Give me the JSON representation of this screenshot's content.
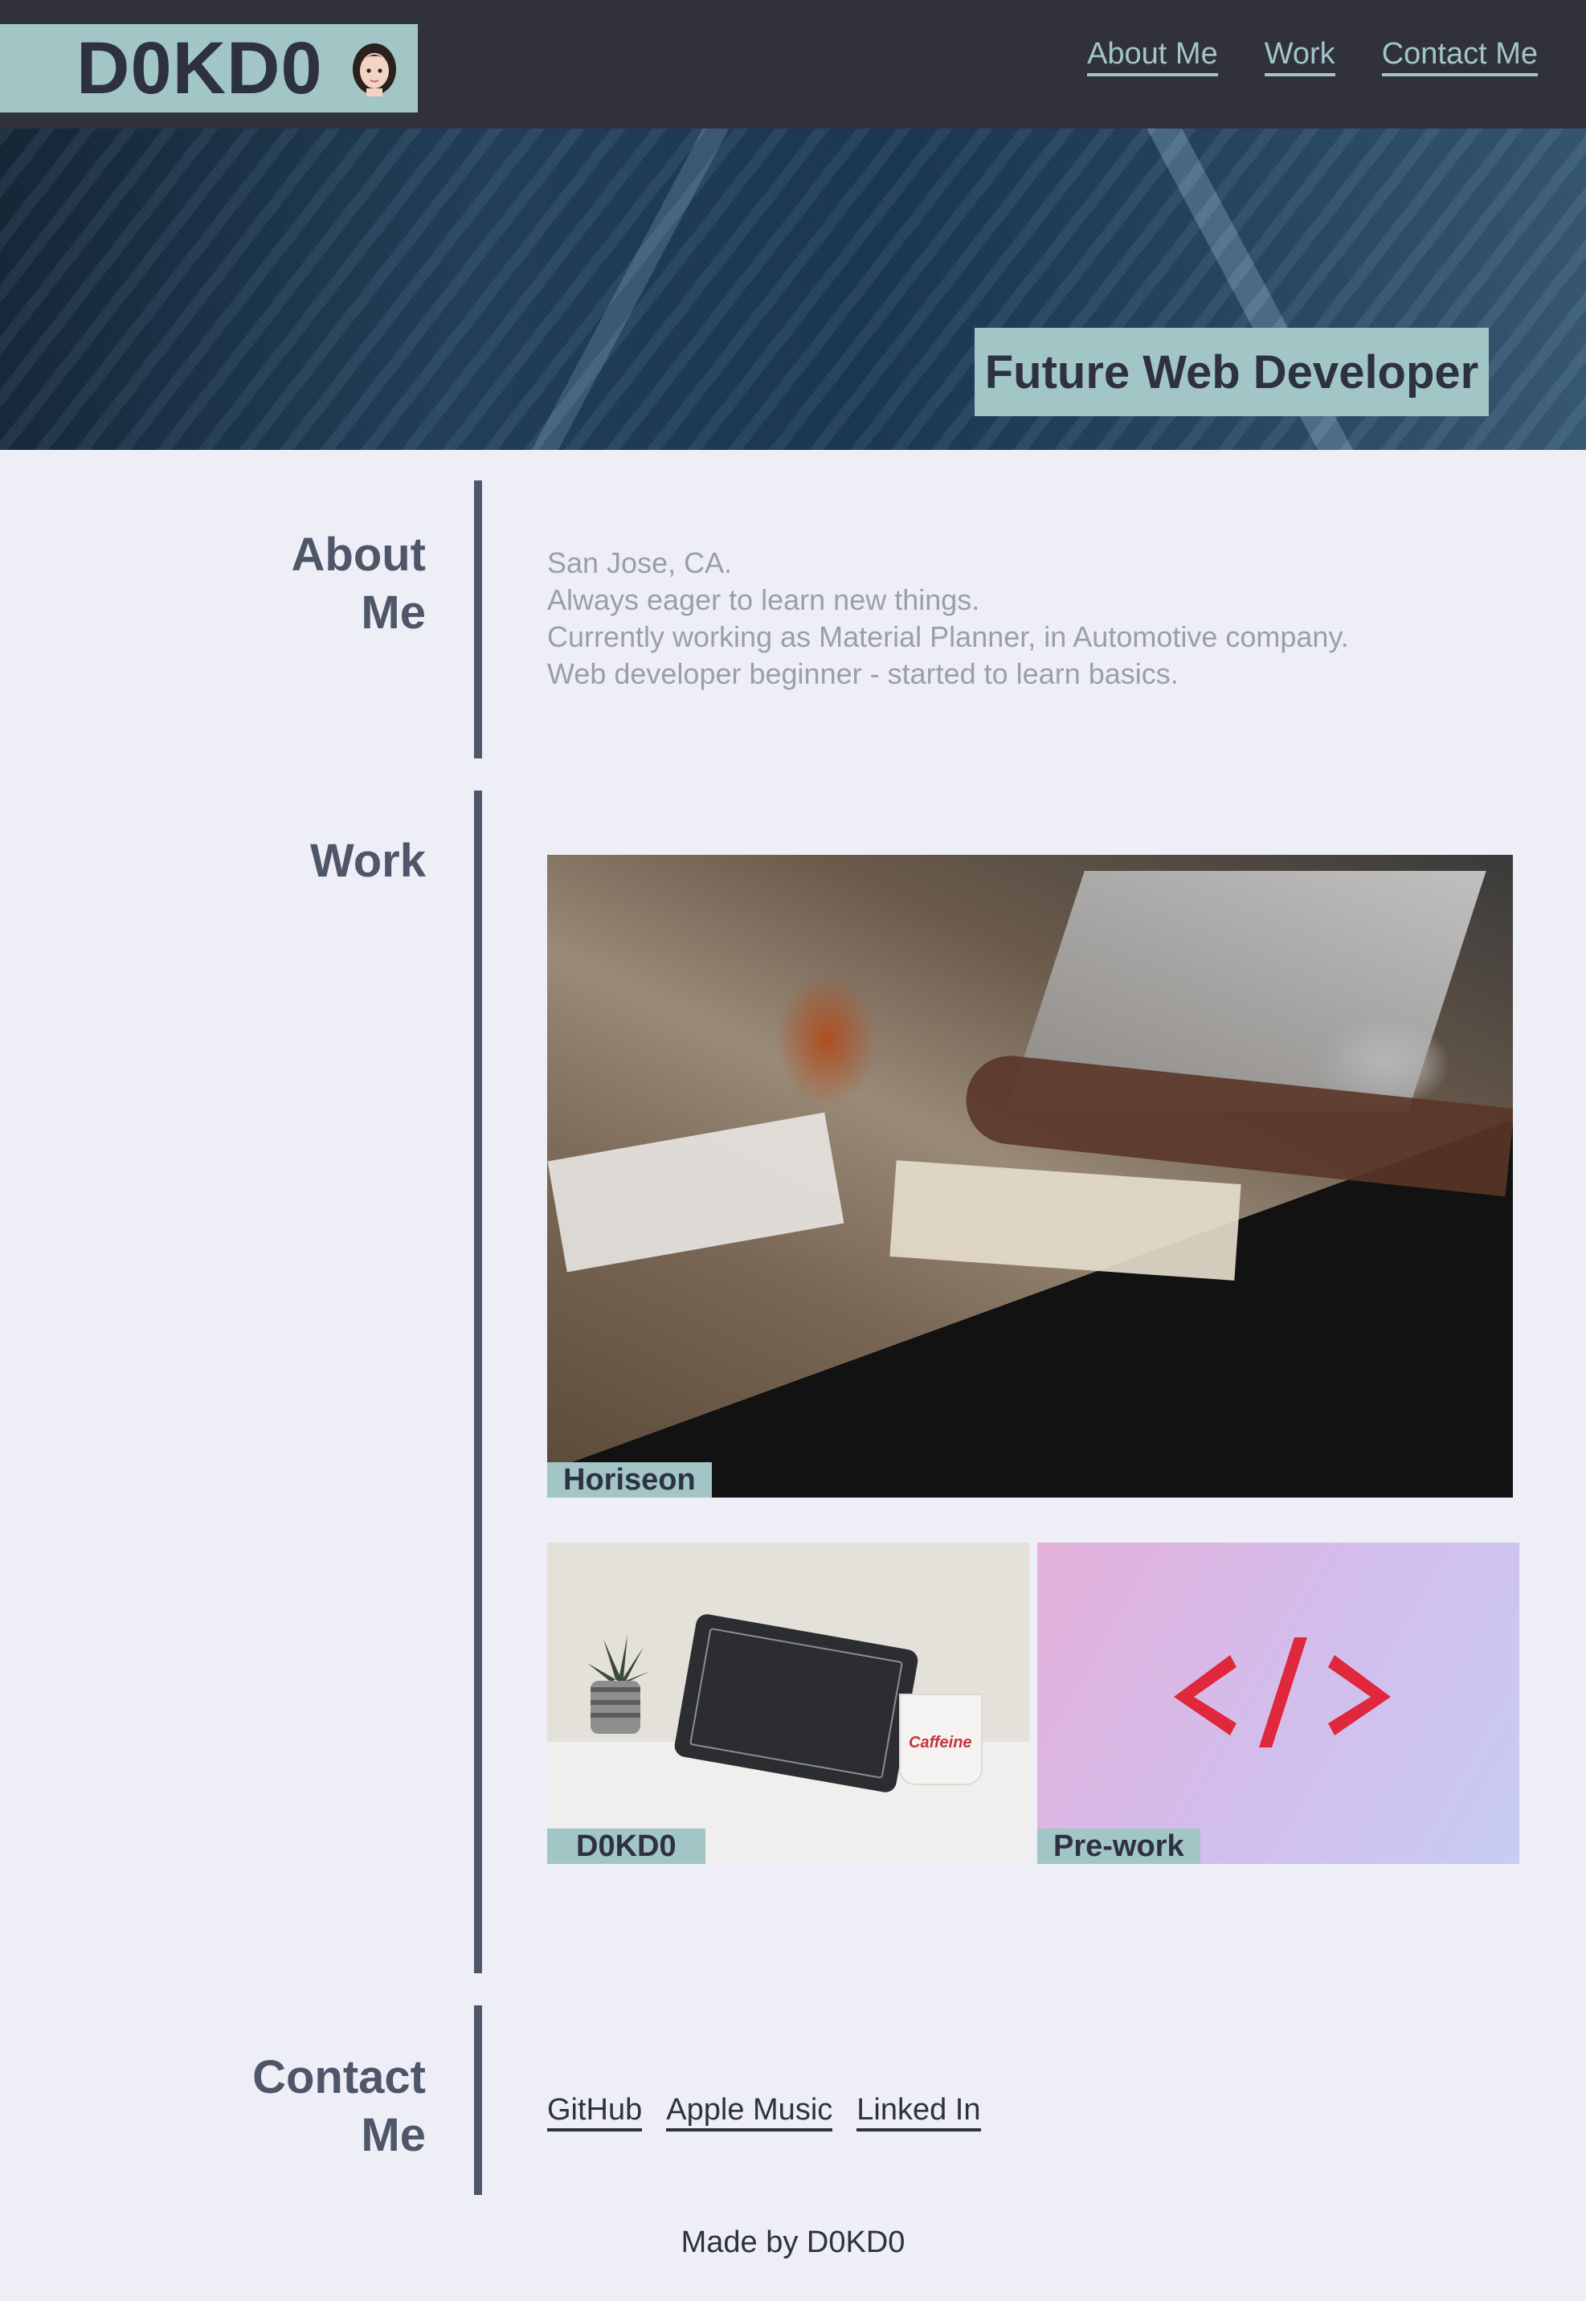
{
  "header": {
    "logo": "D0KD0",
    "avatar_icon": "woman-avatar-icon",
    "nav": [
      {
        "label": "About Me"
      },
      {
        "label": "Work"
      },
      {
        "label": "Contact Me"
      }
    ]
  },
  "hero": {
    "title": "Future Web Developer"
  },
  "about": {
    "heading_line1": "About",
    "heading_line2": "Me",
    "lines": [
      "San Jose, CA.",
      "Always eager to learn new things.",
      "Currently working as Material Planner, in Automotive company.",
      "Web developer beginner - started to learn basics."
    ]
  },
  "work": {
    "heading": "Work",
    "cards": [
      {
        "label": "Horiseon"
      },
      {
        "label": "D0KD0",
        "mug_text": "Caffeine"
      },
      {
        "label": "Pre-work"
      }
    ]
  },
  "contact": {
    "heading_line1": "Contact",
    "heading_line2": "Me",
    "links": [
      {
        "label": "GitHub"
      },
      {
        "label": "Apple Music"
      },
      {
        "label": "Linked In"
      }
    ]
  },
  "footer": {
    "text": "Made by D0KD0"
  },
  "colors": {
    "header_bg": "#30313d",
    "accent": "#a2c5c6",
    "page_bg": "#eeeef6",
    "heading": "#4e5669",
    "body_text": "#9a9eab"
  }
}
